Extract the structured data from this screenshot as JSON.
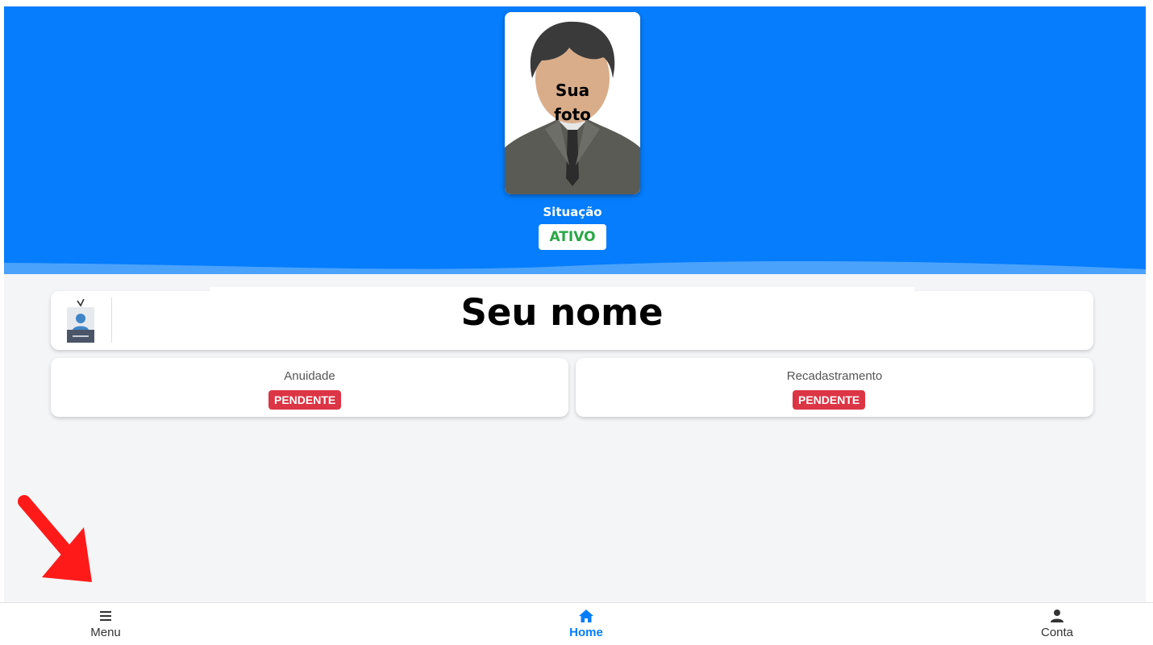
{
  "profile": {
    "photo_caption_line1": "Sua",
    "photo_caption_line2": "foto",
    "status_label": "Situação",
    "status_value": "ATIVO",
    "name": "Seu nome"
  },
  "cards": {
    "anuidade": {
      "label": "Anuidade",
      "status": "PENDENTE"
    },
    "recadastramento": {
      "label": "Recadastramento",
      "status": "PENDENTE"
    }
  },
  "bottom_nav": {
    "menu": {
      "label": "Menu",
      "icon": "hamburger-icon"
    },
    "home": {
      "label": "Home",
      "icon": "home-icon"
    },
    "conta": {
      "label": "Conta",
      "icon": "user-icon"
    }
  },
  "colors": {
    "header_blue": "#057dfc",
    "active_green": "#28a745",
    "pending_red": "#dc3545",
    "annotation_arrow": "#ff1a1a"
  }
}
